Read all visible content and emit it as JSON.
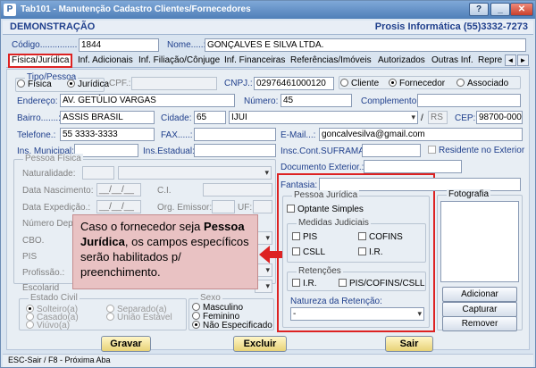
{
  "window": {
    "title": "Tab101 - Manutenção Cadastro Clientes/Fornecedores",
    "controls": {
      "help": "?",
      "minimize": "_",
      "close": "✕"
    }
  },
  "header": {
    "left": "DEMONSTRAÇÃO",
    "right": "Prosis Informática (55)3332-7273"
  },
  "top": {
    "codigo_label": "Código...............",
    "codigo_value": "1844",
    "nome_label": "Nome.....:",
    "nome_value": "GONÇALVES E SILVA LTDA."
  },
  "tabs": [
    "Física/Jurídica",
    "Inf. Adicionais",
    "Inf. Filiação/Cônjuge",
    "Inf. Financeiras",
    "Referências/Imóveis",
    "Autorizados",
    "Outras Inf.",
    "Repre"
  ],
  "tab_nav": {
    "prev": "◄",
    "next": "►"
  },
  "tipo": {
    "legend": "Tipo/Pessoa",
    "fisica": "Física",
    "juridica": "Jurídica",
    "cpf_label": "CPF.:",
    "cpf_value": "",
    "cnpj_label": "CNPJ.:",
    "cnpj_value": "02976461000120",
    "cliente": "Cliente",
    "fornecedor": "Fornecedor",
    "associado": "Associado"
  },
  "endereco": {
    "label": "Endereço:",
    "value": "AV. GETÚLIO VARGAS",
    "numero_label": "Número:",
    "numero_value": "45",
    "complemento_label": "Complemento:",
    "complemento_value": ""
  },
  "bairro": {
    "label": "Bairro.......:",
    "value": "ASSIS BRASIL",
    "cidade_label": "Cidade:",
    "cidade_code": "65",
    "cidade_value": "IJUI",
    "uf_sep": "/",
    "uf_value": "RS",
    "cep_label": "CEP:",
    "cep_value": "98700-000"
  },
  "telefone": {
    "label": "Telefone.:",
    "value": "55 3333-3333",
    "fax_label": "FAX.....:",
    "fax_value": "",
    "email_label": "E-Mail...:",
    "email_value": "goncalvesilva@gmail.com"
  },
  "insc": {
    "municipal_label": "Ins. Municipal:",
    "municipal_value": "",
    "estadual_label": "Ins.Estadual:",
    "estadual_value": "",
    "suframa_label": "Insc.Cont.SUFRAMA:",
    "suframa_value": "",
    "residente_label": "Residente no Exterior"
  },
  "pessoa_fisica": {
    "legend": "Pessoa Física",
    "naturalidade": "Naturalidade:",
    "nascimento": "Data Nascimento:",
    "date_placeholder": "__/__/__",
    "ci": "C.I.",
    "expedicao": "Data Expedição.:",
    "orgao": "Org. Emissor:",
    "uf": "UF:",
    "numero_dep": "Número Dep",
    "cbo": "CBO.",
    "pis": "PIS",
    "profissao": "Profissão.:",
    "escolaridade": "Escolarid"
  },
  "estado_civil": {
    "legend": "Estado Civil",
    "options": [
      "Solteiro(a)",
      "Casado(a)",
      "Viúvo(a)",
      "Separado(a)",
      "União Estável"
    ]
  },
  "sexo": {
    "legend": "Sexo",
    "options": [
      "Masculino",
      "Feminino",
      "Não Especificado"
    ],
    "selected": "Não Especificado"
  },
  "doc_exterior": {
    "label": "Documento Exterior.:",
    "value": ""
  },
  "fantasia": {
    "label": "Fantasia:",
    "value": ""
  },
  "pessoa_juridica": {
    "legend": "Pessoa Jurídica",
    "optante": "Optante Simples",
    "medidas_legend": "Medidas Judiciais",
    "pis": "PIS",
    "cofins": "COFINS",
    "csll": "CSLL",
    "ir": "I.R.",
    "retencoes_legend": "Retenções",
    "ret_ir": "I.R.",
    "ret_pis": "PIS/COFINS/CSLL",
    "natureza_label": "Natureza da Retenção:",
    "natureza_value": "-"
  },
  "fotografia": {
    "legend": "Fotografia",
    "adicionar": "Adicionar",
    "capturar": "Capturar",
    "remover": "Remover"
  },
  "callout": {
    "line1": "Caso o fornecedor seja",
    "bold": "Pessoa Jurídica",
    "line2": ", os campos específicos serão habilitados p/ preenchimento."
  },
  "actions": {
    "gravar": "Gravar",
    "excluir": "Excluir",
    "sair": "Sair"
  },
  "status": "ESC-Sair / F8 - Próxima Aba",
  "colors": {
    "accent": "#1f3f8c",
    "highlight": "#dd2222",
    "callout_bg": "#e9c2c3"
  }
}
